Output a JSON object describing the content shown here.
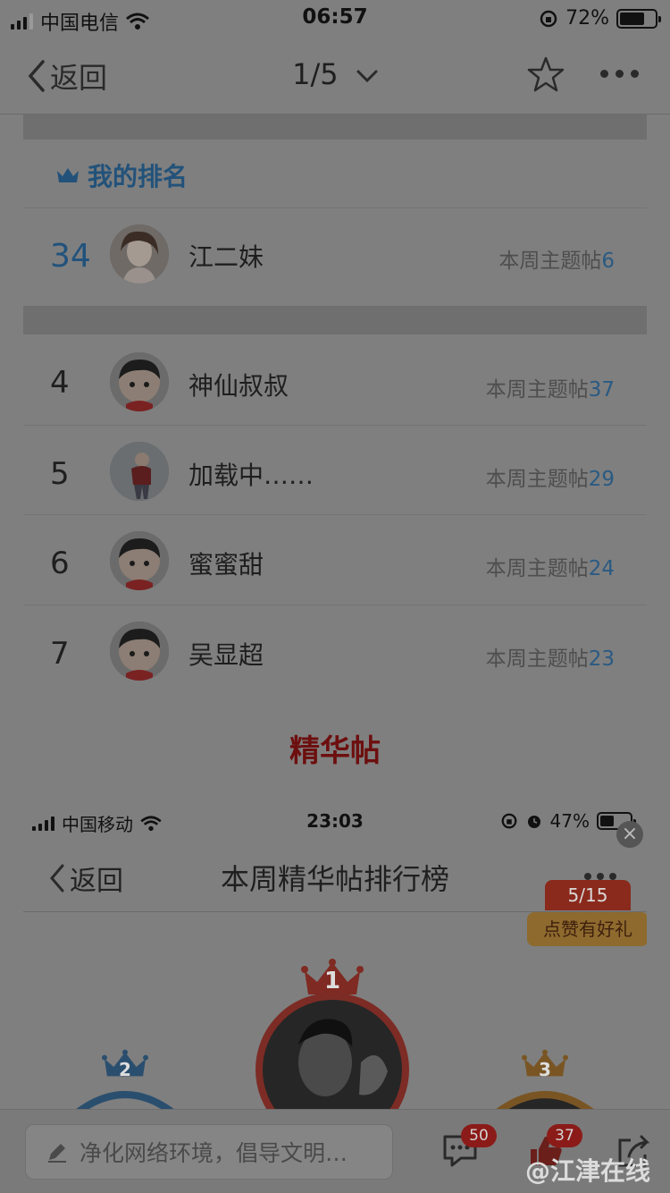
{
  "status_bar": {
    "carrier": "中国电信",
    "time": "06:57",
    "battery_percent": "72%",
    "battery_level": 0.72
  },
  "nav": {
    "back_label": "返回",
    "page_indicator": "1/5"
  },
  "my_rank": {
    "title": "我的排名",
    "rank": "34",
    "name": "江二妹",
    "stat_label": "本周主题帖",
    "stat_value": "6"
  },
  "ranking": [
    {
      "rank": "4",
      "name": "神仙叔叔",
      "stat_label": "本周主题帖",
      "stat_value": "37"
    },
    {
      "rank": "5",
      "name": "加载中……",
      "stat_label": "本周主题帖",
      "stat_value": "29"
    },
    {
      "rank": "6",
      "name": "蜜蜜甜",
      "stat_label": "本周主题帖",
      "stat_value": "24"
    },
    {
      "rank": "7",
      "name": "吴显超",
      "stat_label": "本周主题帖",
      "stat_value": "23"
    }
  ],
  "section_title": "精华帖",
  "embedded": {
    "carrier": "中国移动",
    "time": "23:03",
    "battery_percent": "47%",
    "battery_level": 0.47,
    "back_label": "返回",
    "title": "本周精华帖排行榜",
    "promo_count": "5/15",
    "promo_label": "点赞有好礼",
    "podium": [
      "1",
      "2",
      "3"
    ]
  },
  "bottom_bar": {
    "reply_placeholder": "净化网络环境，倡导文明…",
    "comment_count": "50",
    "like_count": "37"
  },
  "watermark": "@江津在线"
}
